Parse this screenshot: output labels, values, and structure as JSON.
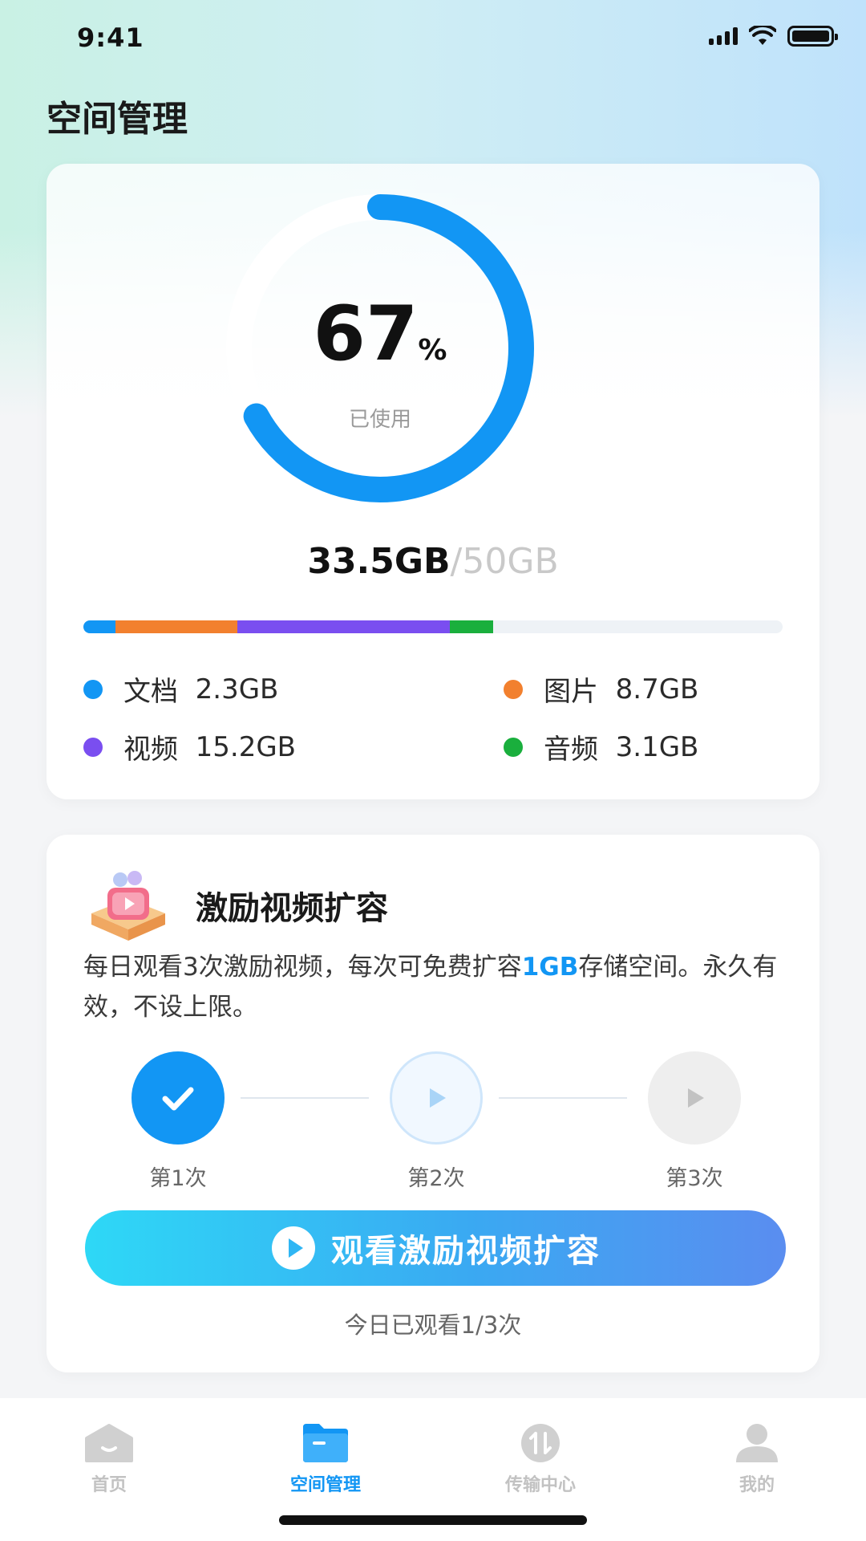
{
  "status_bar": {
    "time": "9:41"
  },
  "page": {
    "title": "空间管理"
  },
  "usage": {
    "percent": "67",
    "percent_sign": "%",
    "used_label": "已使用",
    "used": "33.5GB",
    "separator": "/",
    "total": "50GB",
    "percent_value": 67,
    "categories": [
      {
        "name": "文档",
        "size": "2.3GB",
        "size_gb": 2.3,
        "color": "#1296f4"
      },
      {
        "name": "图片",
        "size": "8.7GB",
        "size_gb": 8.7,
        "color": "#f2802e"
      },
      {
        "name": "视频",
        "size": "15.2GB",
        "size_gb": 15.2,
        "color": "#7a4ef0"
      },
      {
        "name": "音频",
        "size": "3.1GB",
        "size_gb": 3.1,
        "color": "#1aaf3d"
      }
    ]
  },
  "reward": {
    "title": "激励视频扩容",
    "desc_part1": "每日观看3次激励视频，每次可免费扩容",
    "desc_highlight": "1GB",
    "desc_part2": "存储空间。永久有效，不设上限。",
    "steps": [
      {
        "label": "第1次",
        "state": "done"
      },
      {
        "label": "第2次",
        "state": "current"
      },
      {
        "label": "第3次",
        "state": "locked"
      }
    ],
    "button_label": "观看激励视频扩容",
    "today_status": "今日已观看1/3次"
  },
  "tabbar": {
    "items": [
      {
        "label": "首页",
        "icon": "home-icon",
        "active": false
      },
      {
        "label": "空间管理",
        "icon": "folder-icon",
        "active": true
      },
      {
        "label": "传输中心",
        "icon": "transfer-icon",
        "active": false
      },
      {
        "label": "我的",
        "icon": "user-icon",
        "active": false
      }
    ]
  },
  "colors": {
    "accent": "#1296f4",
    "ring_track": "#ffffff",
    "inactive": "#c2c2c2"
  }
}
